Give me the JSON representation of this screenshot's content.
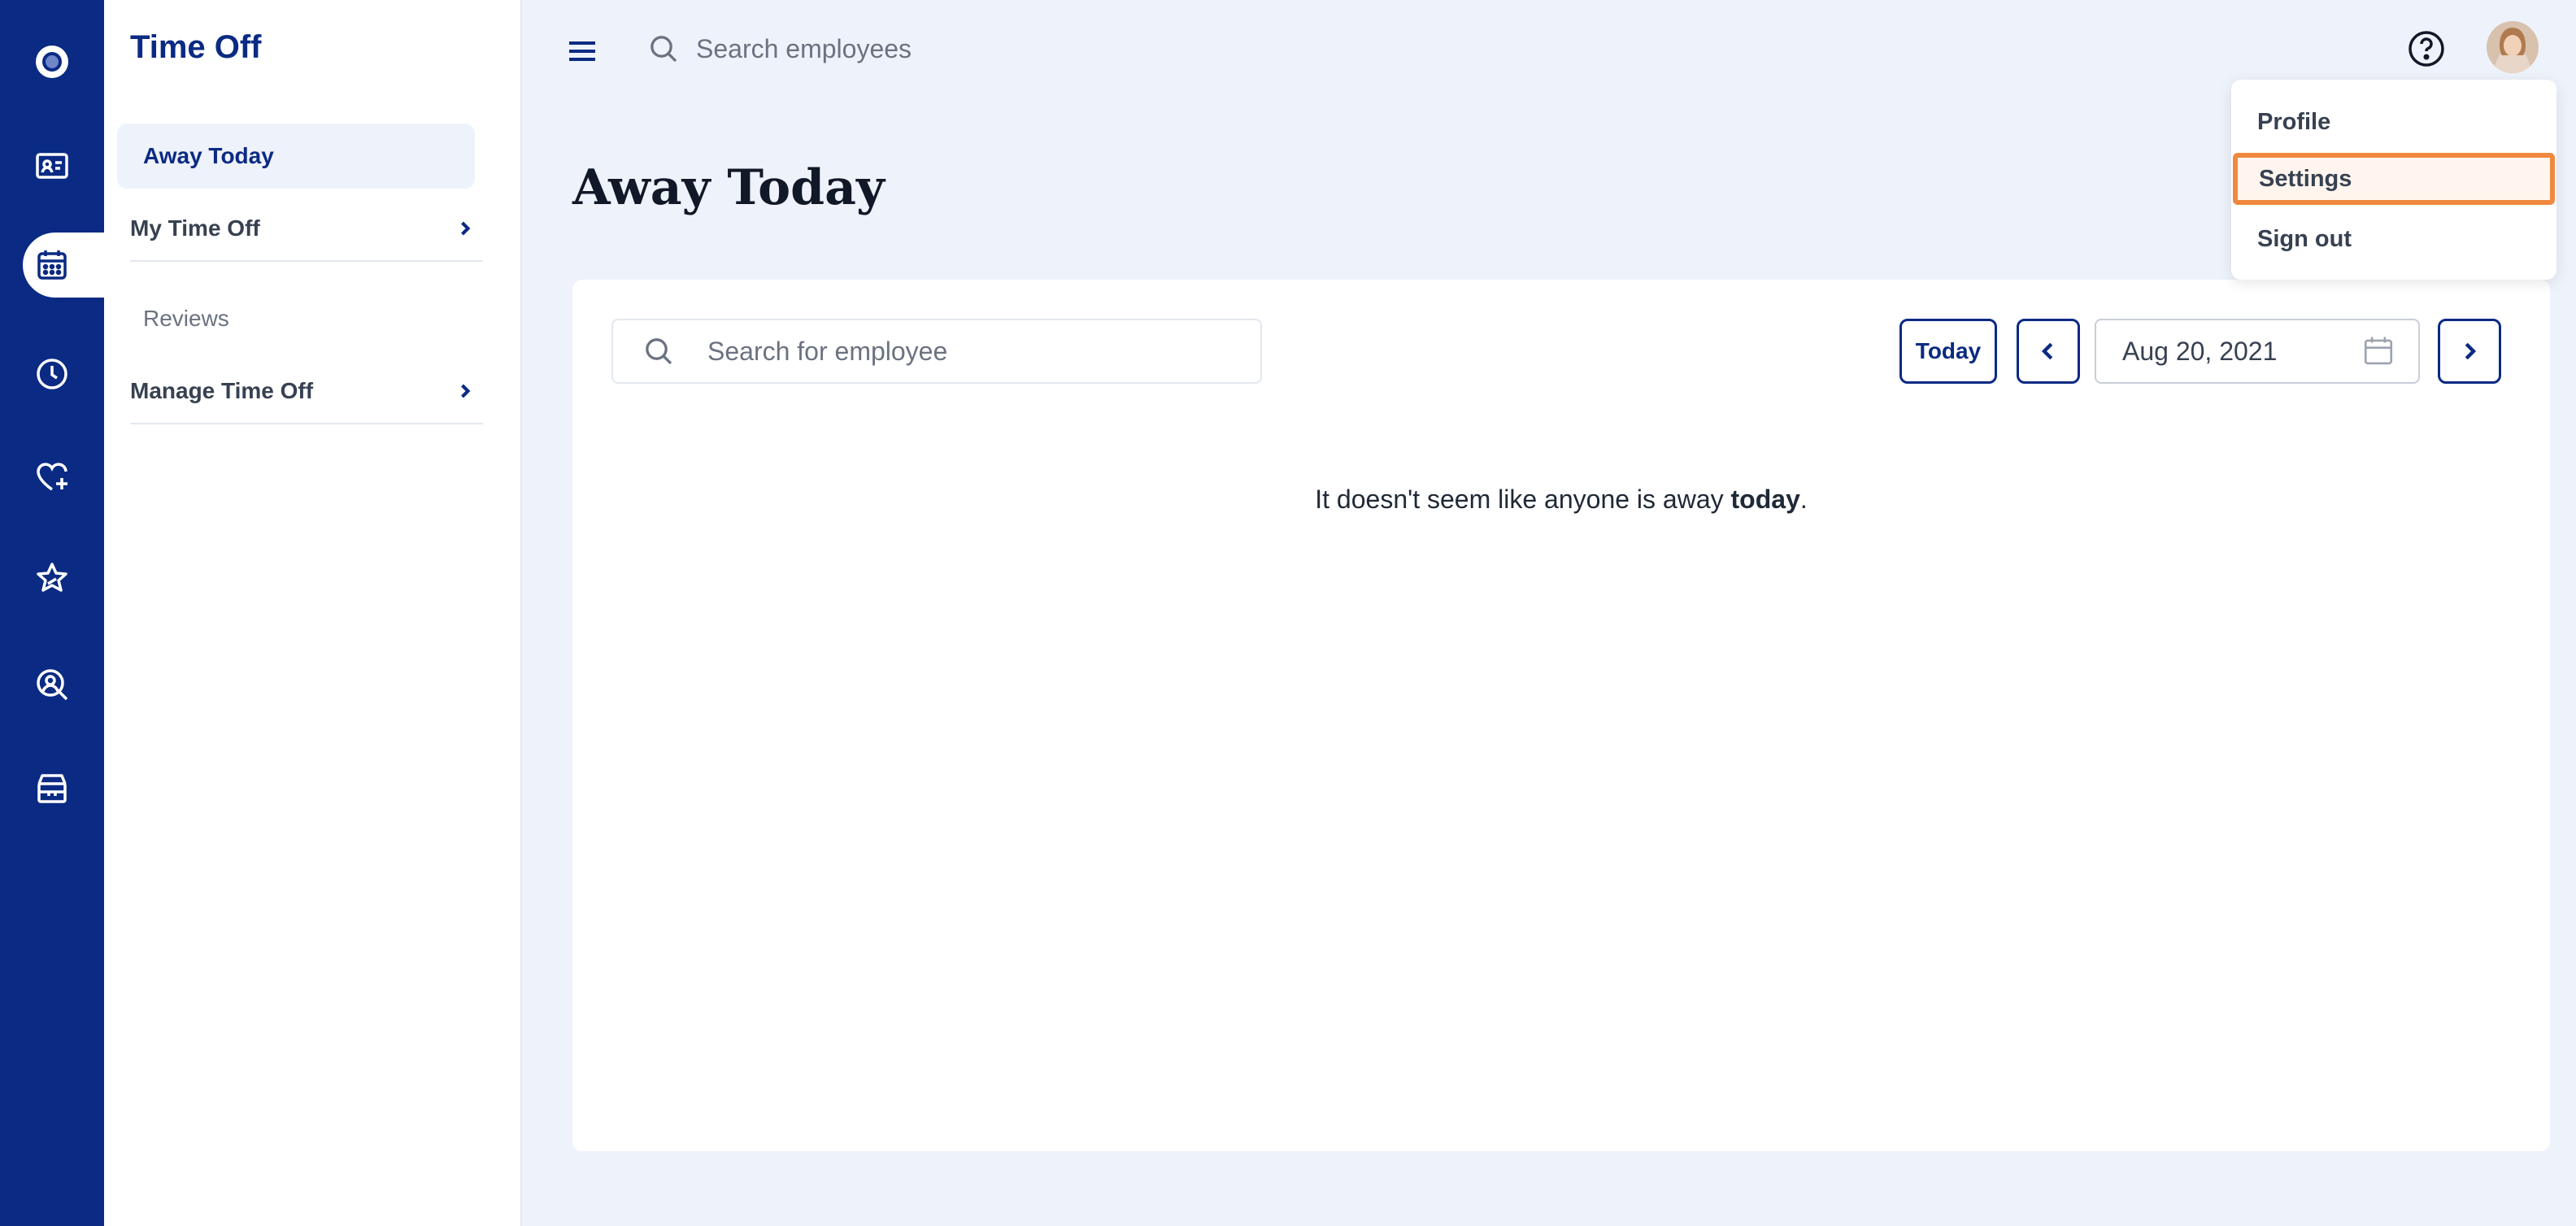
{
  "rail": {
    "items": [
      {
        "icon": "logo-icon"
      },
      {
        "icon": "contact-card-icon"
      },
      {
        "icon": "calendar-icon",
        "active": true
      },
      {
        "icon": "clock-icon"
      },
      {
        "icon": "heart-plus-icon"
      },
      {
        "icon": "star-icon"
      },
      {
        "icon": "person-search-icon"
      },
      {
        "icon": "box-icon"
      }
    ],
    "background": "#0a2a83"
  },
  "subnav": {
    "title": "Time Off",
    "items": [
      {
        "label": "Away Today",
        "active": true
      },
      {
        "label": "My Time Off"
      },
      {
        "label": "Reviews"
      },
      {
        "label": "Manage Time Off"
      }
    ]
  },
  "topbar": {
    "search_placeholder": "Search employees"
  },
  "page": {
    "title": "Away Today"
  },
  "card": {
    "search_placeholder": "Search for employee",
    "today_label": "Today",
    "date_value": "Aug 20, 2021",
    "empty_prefix": "It doesn't seem like anyone is away ",
    "empty_emphasis": "today",
    "empty_suffix": "."
  },
  "user_menu": {
    "items": [
      {
        "label": "Profile"
      },
      {
        "label": "Settings",
        "highlighted": true
      },
      {
        "label": "Sign out"
      }
    ],
    "highlight_color": "#f0883e"
  },
  "colors": {
    "brand": "#0a2a83",
    "page_bg": "#eef2fa",
    "highlight": "#f0883e"
  }
}
